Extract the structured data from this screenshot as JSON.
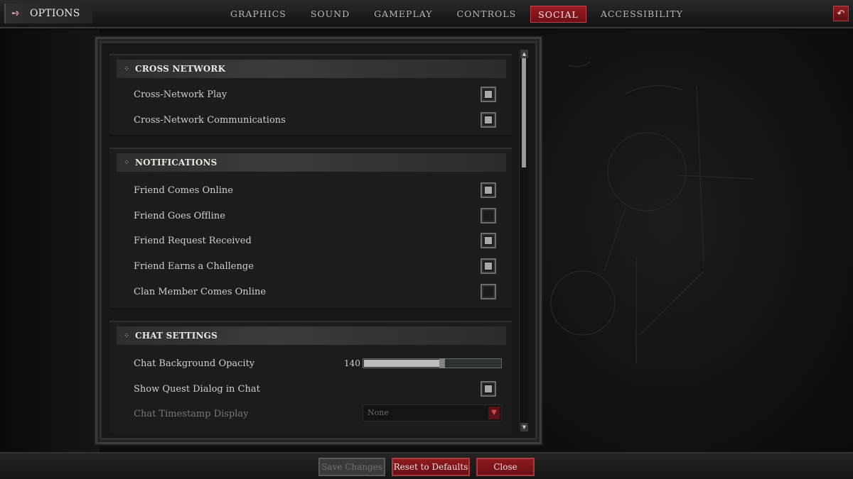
{
  "header": {
    "title": "OPTIONS",
    "title_icon": "arrow-right-icon",
    "tabs": [
      {
        "label": "GRAPHICS",
        "active": false
      },
      {
        "label": "SOUND",
        "active": false
      },
      {
        "label": "GAMEPLAY",
        "active": false
      },
      {
        "label": "CONTROLS",
        "active": false
      },
      {
        "label": "SOCIAL",
        "active": true
      },
      {
        "label": "ACCESSIBILITY",
        "active": false
      }
    ],
    "back_icon": "return-arrow-icon"
  },
  "sections": {
    "cross_network": {
      "title": "CROSS NETWORK",
      "items": [
        {
          "label": "Cross-Network Play",
          "checked": true
        },
        {
          "label": "Cross-Network Communications",
          "checked": true
        }
      ]
    },
    "notifications": {
      "title": "NOTIFICATIONS",
      "items": [
        {
          "label": "Friend Comes Online",
          "checked": true
        },
        {
          "label": "Friend Goes Offline",
          "checked": false
        },
        {
          "label": "Friend Request Received",
          "checked": true
        },
        {
          "label": "Friend Earns a Challenge",
          "checked": true
        },
        {
          "label": "Clan Member Comes Online",
          "checked": false
        }
      ]
    },
    "chat_settings": {
      "title": "CHAT SETTINGS",
      "opacity": {
        "label": "Chat Background Opacity",
        "value": "140",
        "fraction": 0.55
      },
      "quest_dialog": {
        "label": "Show Quest Dialog in Chat",
        "checked": true
      },
      "timestamp": {
        "label": "Chat Timestamp Display",
        "value": "None",
        "disabled": true
      }
    }
  },
  "scrollbar": {
    "position_fraction": 0.0,
    "visible_fraction": 0.3
  },
  "footer": {
    "save_label": "Save Changes",
    "reset_label": "Reset to Defaults",
    "close_label": "Close"
  },
  "colors": {
    "accent_red": "#8e1a20",
    "background": "#0d0d0e",
    "text": "#d3cec6"
  }
}
